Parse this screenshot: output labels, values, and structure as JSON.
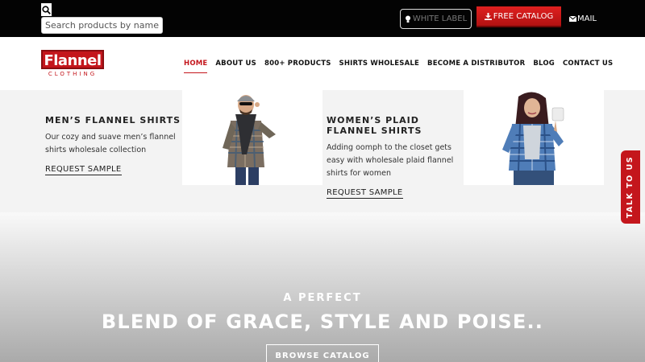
{
  "topbar": {
    "search_placeholder": "Search products by name or",
    "white_label": "WHITE LABEL",
    "free_catalog": "FREE CATALOG",
    "mail": "MAIL"
  },
  "nav": {
    "logo_text": "Flannel",
    "logo_sub": "CLOTHING",
    "links": [
      "HOME",
      "ABOUT US",
      "800+ PRODUCTS",
      "SHIRTS WHOLESALE",
      "BECOME A DISTRIBUTOR",
      "BLOG",
      "CONTACT US"
    ]
  },
  "products": [
    {
      "title": "MEN’S FLANNEL SHIRTS",
      "desc": "Our cozy and suave men’s flannel shirts wholesale collection",
      "cta": "REQUEST SAMPLE"
    },
    {
      "title": "WOMEN’S PLAID FLANNEL SHIRTS",
      "desc": "Adding oomph to the closet gets easy with wholesale plaid flannel shirts for women",
      "cta": "REQUEST SAMPLE"
    }
  ],
  "hero": {
    "subtitle": "A PERFECT",
    "title": "BLEND OF GRACE, STYLE AND POISE..",
    "button": "BROWSE CATALOG"
  },
  "talk_tab": "TALK TO US",
  "colors": {
    "brand": "#c4161c",
    "topbar": "#030303"
  },
  "icons": [
    "search-icon",
    "bulb-icon",
    "download-icon",
    "mail-icon"
  ]
}
